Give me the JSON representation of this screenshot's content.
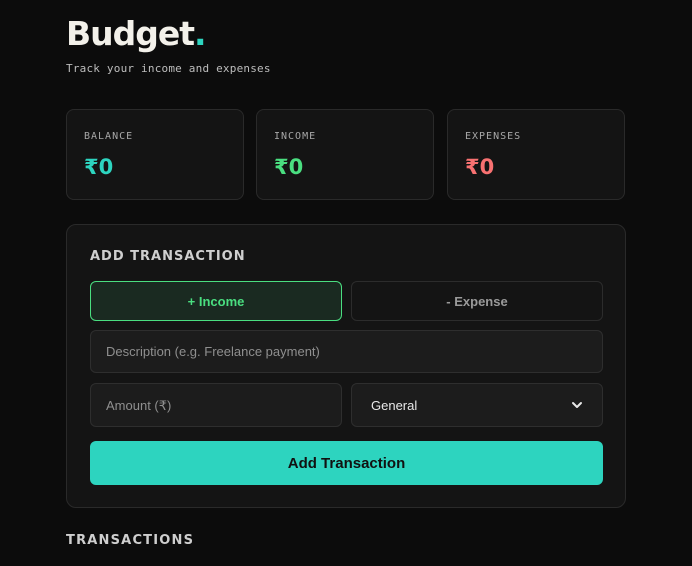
{
  "header": {
    "title": "Budget",
    "title_dot": ".",
    "subtitle": "Track your income and expenses"
  },
  "summary": [
    {
      "label": "BALANCE",
      "value": "₹0",
      "color": "#2dd4bf"
    },
    {
      "label": "INCOME",
      "value": "₹0",
      "color": "#4ade80"
    },
    {
      "label": "EXPENSES",
      "value": "₹0",
      "color": "#f87171"
    }
  ],
  "form": {
    "title": "ADD TRANSACTION",
    "income_label": "+ Income",
    "expense_label": "- Expense",
    "description_placeholder": "Description (e.g. Freelance payment)",
    "amount_placeholder": "Amount (₹)",
    "category_selected": "General",
    "submit_label": "Add Transaction"
  },
  "transactions": {
    "title": "TRANSACTIONS"
  },
  "colors": {
    "accent": "#2dd4bf",
    "income": "#4ade80",
    "expense": "#f87171",
    "background": "#0c0c0c"
  },
  "icons": {
    "select_arrow": "chevron-down-icon"
  }
}
